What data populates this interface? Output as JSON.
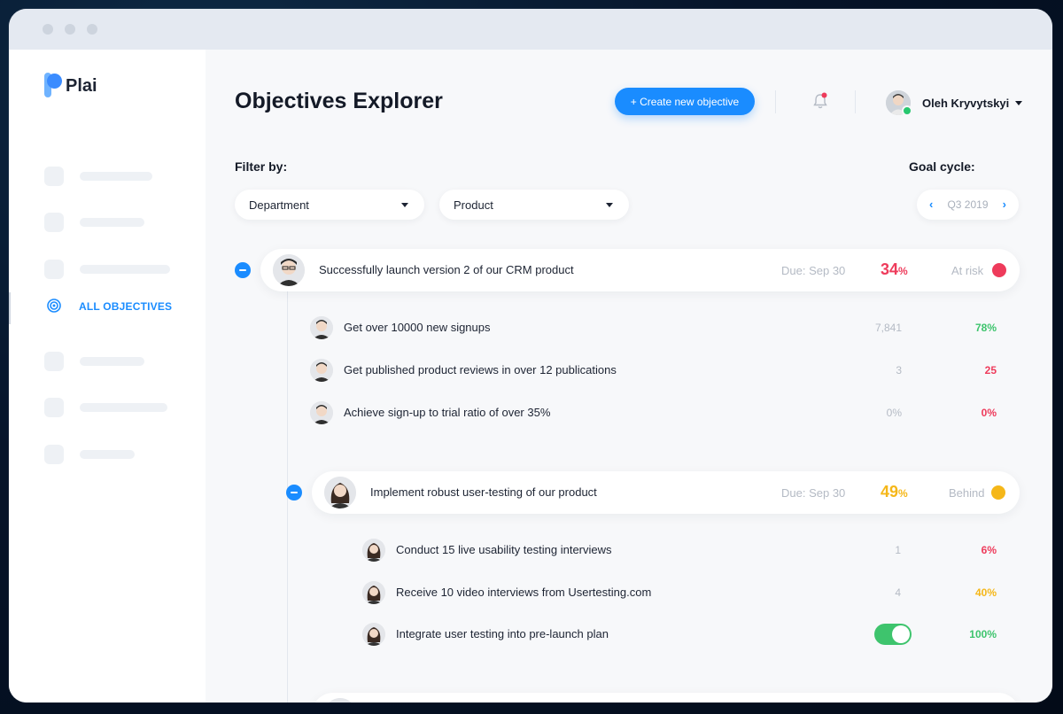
{
  "app": {
    "name": "Plai"
  },
  "sidebar": {
    "active_label": "ALL OBJECTIVES",
    "accent": "#1a8cff"
  },
  "header": {
    "title": "Objectives Explorer",
    "create_label": "+ Create new objective",
    "user_name": "Oleh Kryvytskyi",
    "notification_icon": "bell-icon"
  },
  "filters": {
    "label": "Filter by:",
    "department": "Department",
    "product": "Product",
    "goal_cycle_label": "Goal cycle:",
    "goal_cycle_value": "Q3 2019",
    "prev_glyph": "‹",
    "next_glyph": "›"
  },
  "objectives": [
    {
      "title": "Successfully launch version 2 of our CRM product",
      "due": "Due: Sep 30",
      "percent": "34",
      "percent_unit": "%",
      "percent_color": "#ee3b5b",
      "status": "At risk",
      "status_color": "#ee3b5b",
      "key_results": [
        {
          "title": "Get over 10000 new signups",
          "current": "7,841",
          "percent": "78%",
          "color": "#3ec46d"
        },
        {
          "title": "Get published product reviews in over 12 publications",
          "current": "3",
          "percent": "25",
          "color": "#ee3b5b"
        },
        {
          "title": "Achieve sign-up to trial ratio of over 35%",
          "current": "0%",
          "percent": "0%",
          "color": "#ee3b5b"
        }
      ]
    },
    {
      "title": "Implement robust user-testing of our product",
      "due": "Due: Sep 30",
      "percent": "49",
      "percent_unit": "%",
      "percent_color": "#f5b719",
      "status": "Behind",
      "status_color": "#f5b719",
      "key_results": [
        {
          "title": "Conduct 15 live usability testing interviews",
          "current": "1",
          "percent": "6%",
          "color": "#ee3b5b"
        },
        {
          "title": "Receive 10 video interviews from Usertesting.com",
          "current": "4",
          "percent": "40%",
          "color": "#f5b719"
        },
        {
          "title": "Integrate user testing into pre-launch plan",
          "current": "",
          "percent": "100%",
          "color": "#3ec46d",
          "toggle": true
        }
      ]
    }
  ]
}
